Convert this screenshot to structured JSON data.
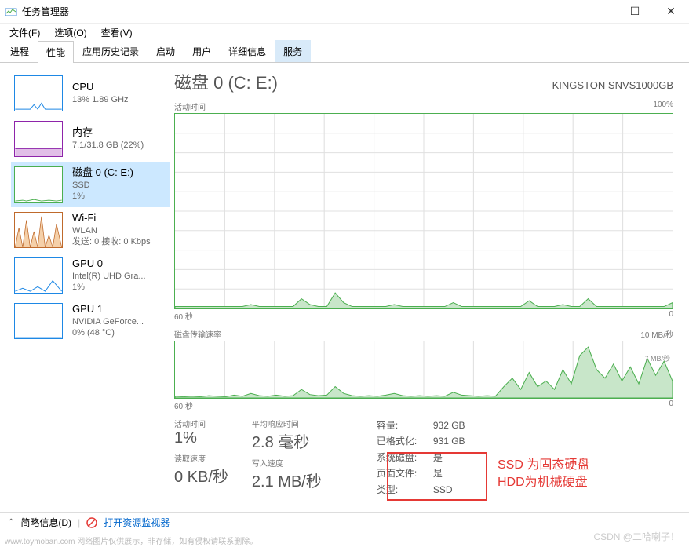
{
  "window": {
    "title": "任务管理器",
    "min": "—",
    "max": "☐",
    "close": "✕"
  },
  "menu": {
    "file": "文件(F)",
    "options": "选项(O)",
    "view": "查看(V)"
  },
  "tabs": {
    "processes": "进程",
    "performance": "性能",
    "history": "应用历史记录",
    "startup": "启动",
    "users": "用户",
    "details": "详细信息",
    "services": "服务"
  },
  "sidebar": {
    "cpu": {
      "title": "CPU",
      "sub": "13% 1.89 GHz",
      "color": "#1e88e5"
    },
    "memory": {
      "title": "内存",
      "sub": "7.1/31.8 GB (22%)",
      "color": "#8e24aa"
    },
    "disk": {
      "title": "磁盘 0 (C: E:)",
      "sub1": "SSD",
      "sub2": "1%",
      "color": "#4caf50"
    },
    "wifi": {
      "title": "Wi-Fi",
      "sub1": "WLAN",
      "sub2": "发送: 0 接收: 0 Kbps",
      "color": "#bf6a2c"
    },
    "gpu0": {
      "title": "GPU 0",
      "sub1": "Intel(R) UHD Gra...",
      "sub2": "1%",
      "color": "#1e88e5"
    },
    "gpu1": {
      "title": "GPU 1",
      "sub1": "NVIDIA GeForce...",
      "sub2": "0% (48 °C)",
      "color": "#1e88e5"
    }
  },
  "main": {
    "title": "磁盘 0 (C: E:)",
    "model": "KINGSTON SNVS1000GB",
    "activity_label": "活动时间",
    "activity_max": "100%",
    "transfer_label": "磁盘传输速率",
    "transfer_max": "10 MB/秒",
    "transfer_dash": "7 MB/秒",
    "axis_left": "60 秒",
    "axis_right": "0"
  },
  "stats": {
    "active_label": "活动时间",
    "active_value": "1%",
    "resp_label": "平均响应时间",
    "resp_value": "2.8 毫秒",
    "read_label": "读取速度",
    "read_value": "0 KB/秒",
    "write_label": "写入速度",
    "write_value": "2.1 MB/秒"
  },
  "kv": {
    "capacity_k": "容量:",
    "capacity_v": "932 GB",
    "formatted_k": "已格式化:",
    "formatted_v": "931 GB",
    "system_k": "系统磁盘:",
    "system_v": "是",
    "pagefile_k": "页面文件:",
    "pagefile_v": "是",
    "type_k": "类型:",
    "type_v": "SSD"
  },
  "statusbar": {
    "fewer": "简略信息(D)",
    "resmon": "打开资源监视器"
  },
  "annotation": {
    "line1": "SSD 为固态硬盘",
    "line2": "HDD为机械硬盘"
  },
  "watermark": "www.toymoban.com 网络图片仅供展示，非存储，如有侵权请联系删除。",
  "csdn": "CSDN @二哈喇子！",
  "chart_data": [
    {
      "type": "area",
      "title": "活动时间",
      "ylabel": "%",
      "ylim": [
        0,
        100
      ],
      "xlim_seconds": [
        60,
        0
      ],
      "values_pct": [
        1,
        1,
        1,
        1,
        1,
        1,
        1,
        1,
        1,
        2,
        1,
        1,
        1,
        1,
        1,
        5,
        2,
        1,
        1,
        8,
        3,
        1,
        1,
        1,
        1,
        1,
        2,
        1,
        1,
        1,
        1,
        1,
        1,
        3,
        1,
        1,
        1,
        1,
        1,
        1,
        1,
        1,
        4,
        1,
        1,
        1,
        2,
        1,
        1,
        5,
        1,
        1,
        1,
        1,
        1,
        1,
        1,
        1,
        1,
        3
      ]
    },
    {
      "type": "area",
      "title": "磁盘传输速率",
      "ylabel": "MB/秒",
      "ylim": [
        0,
        10
      ],
      "xlim_seconds": [
        60,
        0
      ],
      "dashed_line": 7,
      "values_mbps": [
        0.3,
        0.2,
        0.3,
        0.2,
        0.4,
        0.3,
        0.2,
        0.5,
        0.3,
        0.8,
        0.4,
        0.3,
        0.5,
        0.3,
        0.4,
        1.5,
        0.6,
        0.4,
        0.5,
        2.0,
        0.8,
        0.4,
        0.3,
        0.4,
        0.3,
        0.5,
        0.8,
        0.4,
        0.3,
        0.4,
        0.3,
        0.4,
        0.3,
        1.0,
        0.5,
        0.4,
        0.3,
        0.4,
        0.3,
        2.0,
        3.5,
        1.5,
        4.5,
        2.0,
        3.0,
        1.5,
        5.0,
        2.5,
        7.5,
        9.0,
        5.0,
        3.5,
        6.0,
        3.0,
        5.5,
        2.5,
        7.0,
        4.0,
        6.5,
        3.0
      ]
    }
  ]
}
